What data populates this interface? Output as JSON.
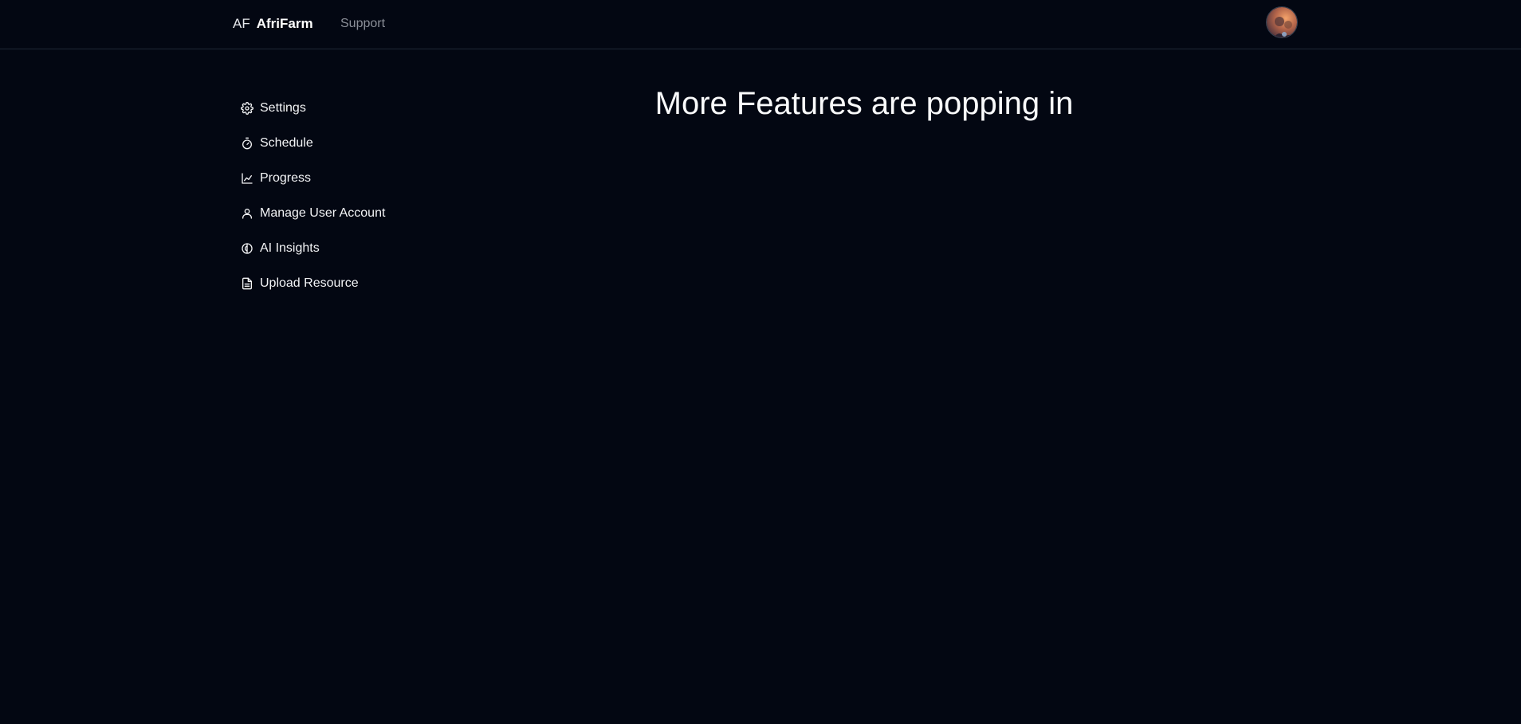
{
  "header": {
    "brand_abbr": "AF",
    "brand_name": "AfriFarm",
    "nav_support": "Support"
  },
  "sidebar": {
    "items": [
      {
        "label": "Settings",
        "icon": "gear-icon"
      },
      {
        "label": "Schedule",
        "icon": "timer-icon"
      },
      {
        "label": "Progress",
        "icon": "line-chart-icon"
      },
      {
        "label": "Manage User Account",
        "icon": "user-icon"
      },
      {
        "label": "AI Insights",
        "icon": "brain-icon"
      },
      {
        "label": "Upload Resource",
        "icon": "document-icon"
      }
    ]
  },
  "main": {
    "heading": "More Features are popping in"
  },
  "colors": {
    "background": "#030712",
    "text": "#f3f4f6",
    "muted": "#8b8f98",
    "divider": "#1f2937"
  }
}
